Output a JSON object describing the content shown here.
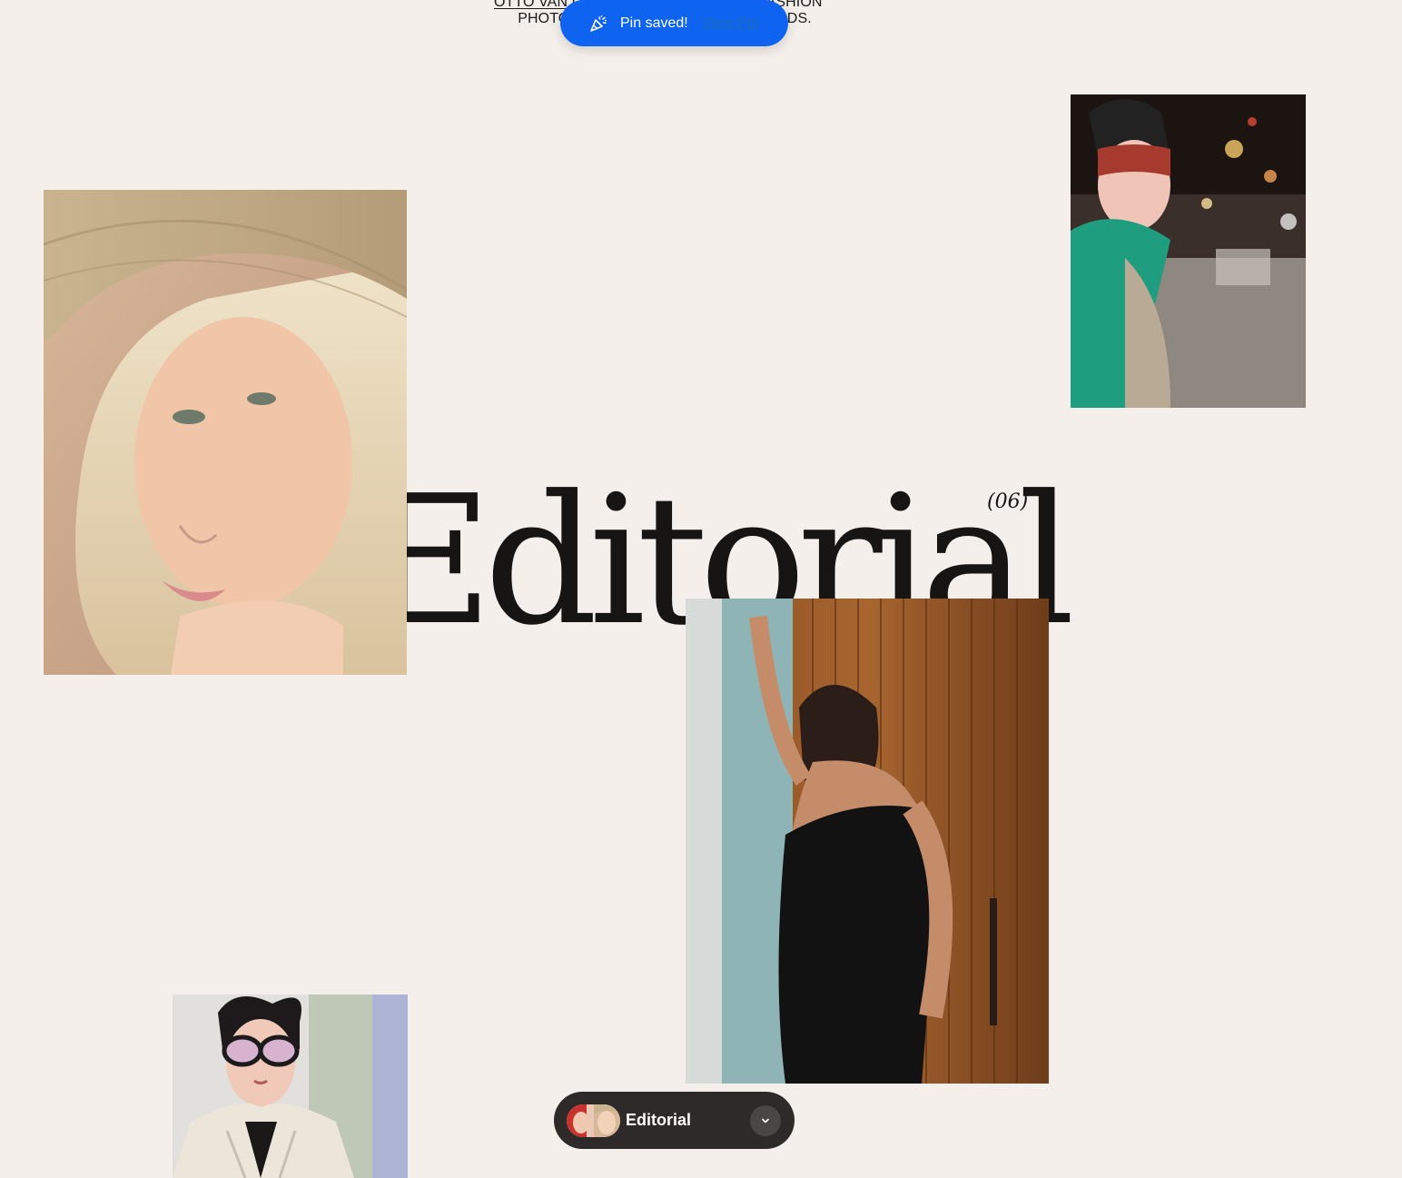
{
  "intro": {
    "line1_link": "OTTO VAN DEN TOORN",
    "line1_rest": " IS BEAUTY & FASHION",
    "line2": "PHOTOGRAPHER IN THE NETHERLANDS."
  },
  "toast": {
    "icon": "party-popper-icon",
    "message": "Pin saved!",
    "link_label": "View Pin",
    "background": "#0e63f0"
  },
  "headline": {
    "title": "Editorial",
    "count": "(06)"
  },
  "photos": [
    {
      "name": "woman in straw hat"
    },
    {
      "name": "woman in green ruffles at night"
    },
    {
      "name": "woman in black velvet dress"
    },
    {
      "name": "person in oversized glasses"
    }
  ],
  "board_pill": {
    "label": "Editorial",
    "icon": "chevron-down-icon",
    "background": "#2d2a29"
  }
}
